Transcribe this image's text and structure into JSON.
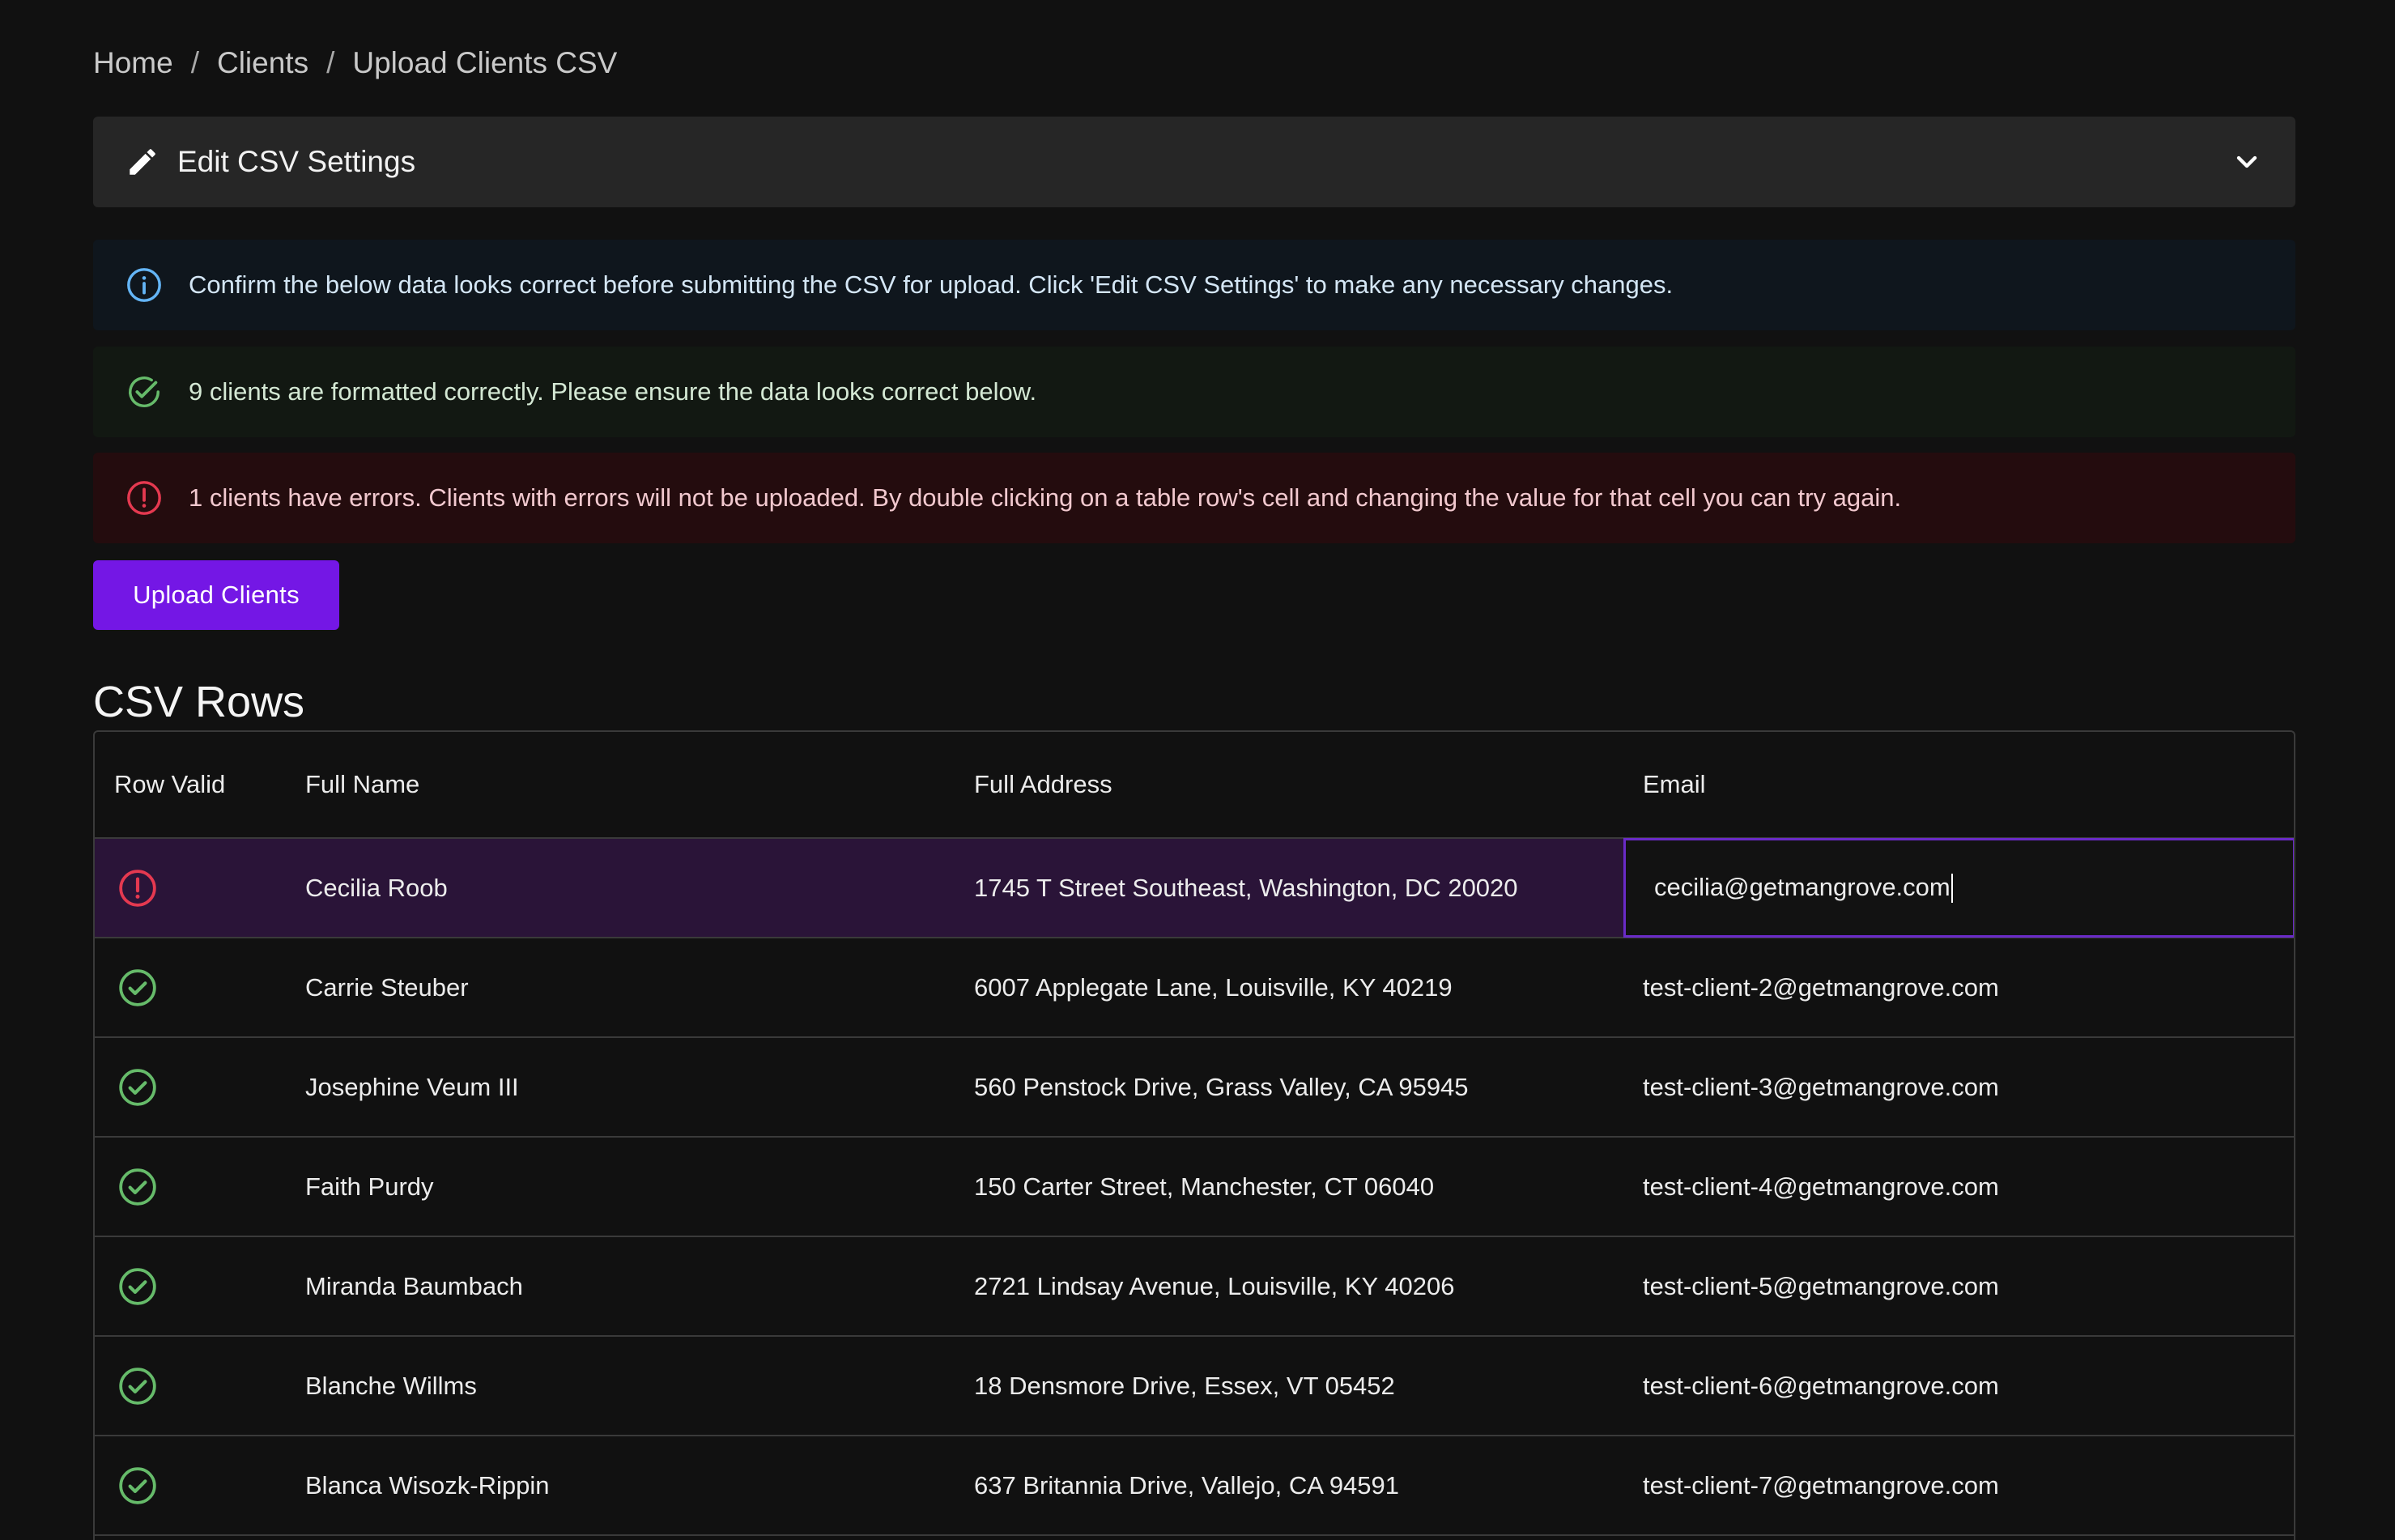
{
  "breadcrumb": {
    "items": [
      "Home",
      "Clients",
      "Upload Clients CSV"
    ],
    "separator": "/"
  },
  "settings": {
    "title": "Edit CSV Settings"
  },
  "alerts": {
    "info": "Confirm the below data looks correct before submitting the CSV for upload. Click 'Edit CSV Settings' to make any necessary changes.",
    "success": "9 clients are formatted correctly. Please ensure the data looks correct below.",
    "error": "1 clients have errors. Clients with errors will not be uploaded. By double clicking on a table row's cell and changing the value for that cell you can try again."
  },
  "upload_button": {
    "label": "Upload Clients"
  },
  "section": {
    "title": "CSV Rows"
  },
  "table": {
    "headers": [
      "Row Valid",
      "Full Name",
      "Full Address",
      "Email"
    ],
    "rows": [
      {
        "valid": false,
        "name": "Cecilia Roob",
        "address": "1745 T Street Southeast, Washington, DC 20020",
        "email": "cecilia@getmangrove.com"
      },
      {
        "valid": true,
        "name": "Carrie Steuber",
        "address": "6007 Applegate Lane, Louisville, KY 40219",
        "email": "test-client-2@getmangrove.com"
      },
      {
        "valid": true,
        "name": "Josephine Veum III",
        "address": "560 Penstock Drive, Grass Valley, CA 95945",
        "email": "test-client-3@getmangrove.com"
      },
      {
        "valid": true,
        "name": "Faith Purdy",
        "address": "150 Carter Street, Manchester, CT 06040",
        "email": "test-client-4@getmangrove.com"
      },
      {
        "valid": true,
        "name": "Miranda Baumbach",
        "address": "2721 Lindsay Avenue, Louisville, KY 40206",
        "email": "test-client-5@getmangrove.com"
      },
      {
        "valid": true,
        "name": "Blanche Willms",
        "address": "18 Densmore Drive, Essex, VT 05452",
        "email": "test-client-6@getmangrove.com"
      },
      {
        "valid": true,
        "name": "Blanca Wisozk-Rippin",
        "address": "637 Britannia Drive, Vallejo, CA 94591",
        "email": "test-client-7@getmangrove.com"
      }
    ]
  },
  "colors": {
    "background": "#111111",
    "accent": "#7417e5",
    "info": "#64b5f6",
    "success": "#66bb6a",
    "error": "#e53950"
  }
}
